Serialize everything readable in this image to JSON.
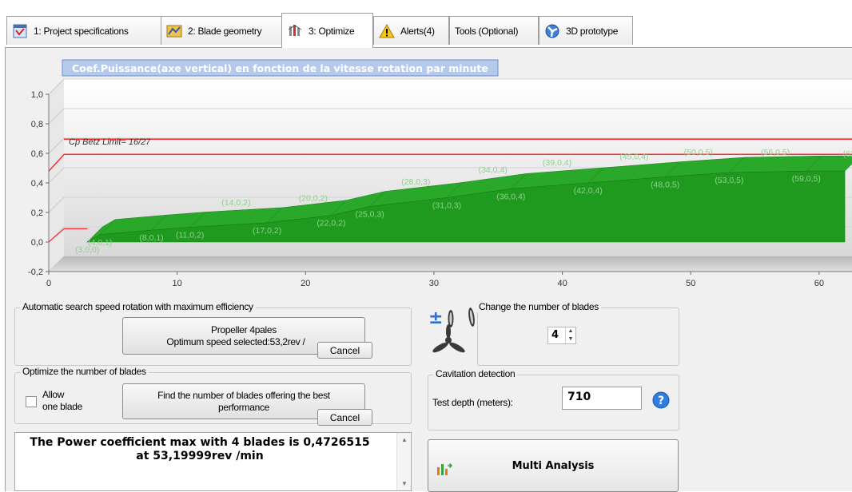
{
  "tabs": [
    {
      "label": "1: Project specifications",
      "icon": "spec-icon"
    },
    {
      "label": "2: Blade geometry",
      "icon": "geometry-icon"
    },
    {
      "label": "3: Optimize",
      "icon": "optimize-icon"
    },
    {
      "label": "Alerts(4)",
      "icon": "alert-icon"
    },
    {
      "label": "Tools (Optional)",
      "icon": ""
    },
    {
      "label": "3D prototype",
      "icon": "prototype-icon"
    }
  ],
  "chart_data": {
    "type": "area",
    "title": "Coef.Puissance(axe vertical) en fonction de la vitesse rotation par minute",
    "xlim": [
      0,
      62
    ],
    "ylim": [
      -0.2,
      1.0
    ],
    "x_ticks": [
      "0",
      "10",
      "20",
      "30",
      "40",
      "50",
      "60"
    ],
    "y_ticks": [
      "-0,2",
      "0,0",
      "0,2",
      "0,4",
      "0,6",
      "0,8",
      "1,0"
    ],
    "betz_limit": {
      "value": 0.593,
      "label": "Cp Betz Limit= 16/27"
    },
    "series_color": "#1f9a1f",
    "limit_color": "#ff2a2a",
    "front_points": [
      {
        "x": 3,
        "y": 0.0,
        "label": "(3,0,0)"
      },
      {
        "x": 4,
        "y": 0.05,
        "label": "(4,0,1)"
      },
      {
        "x": 8,
        "y": 0.08,
        "label": "(8,0,1)"
      },
      {
        "x": 11,
        "y": 0.1,
        "label": "(11,0,2)"
      },
      {
        "x": 17,
        "y": 0.13,
        "label": "(17,0,2)"
      },
      {
        "x": 22,
        "y": 0.18,
        "label": "(22,0,2)"
      },
      {
        "x": 25,
        "y": 0.24,
        "label": "(25,0,3)"
      },
      {
        "x": 31,
        "y": 0.3,
        "label": "(31,0,3)"
      },
      {
        "x": 36,
        "y": 0.36,
        "label": "(36,0,4)"
      },
      {
        "x": 42,
        "y": 0.4,
        "label": "(42,0,4)"
      },
      {
        "x": 48,
        "y": 0.44,
        "label": "(48,0,5)"
      },
      {
        "x": 53,
        "y": 0.47,
        "label": "(53,0,5)"
      },
      {
        "x": 59,
        "y": 0.48,
        "label": "(59,0,5)"
      }
    ],
    "back_points": [
      {
        "x": 14,
        "y": 0.22,
        "label": "(14,0,2)"
      },
      {
        "x": 20,
        "y": 0.25,
        "label": "(20,0,2)"
      },
      {
        "x": 28,
        "y": 0.36,
        "label": "(28,0,3)"
      },
      {
        "x": 34,
        "y": 0.44,
        "label": "(34,0,4)"
      },
      {
        "x": 39,
        "y": 0.49,
        "label": "(39,0,4)"
      },
      {
        "x": 45,
        "y": 0.53,
        "label": "(45,0,4)"
      },
      {
        "x": 50,
        "y": 0.56,
        "label": "(50,0,5)"
      },
      {
        "x": 56,
        "y": 0.56,
        "label": "(56,0,5)"
      },
      {
        "x": 62,
        "y": 0.55,
        "label": "(62,0"
      }
    ]
  },
  "auto_search": {
    "legend": "Automatic search speed rotation with maximum efficiency",
    "button_line1": "Propeller 4pales",
    "button_line2": "Optimum speed selected:53,2rev /",
    "cancel": "Cancel"
  },
  "optimize_blades": {
    "legend": "Optimize the number of blades",
    "checkbox_label_1": "Allow",
    "checkbox_label_2": "one blade",
    "button_line1": "Find the number of blades offering the best",
    "button_line2": "performance",
    "cancel": "Cancel"
  },
  "blades": {
    "legend": "Change the number of blades",
    "value": "4"
  },
  "cavitation": {
    "legend": "Cavitation  detection",
    "label": "Test depth (meters):",
    "value": "710"
  },
  "result": {
    "line1": "The Power coefficient  max with 4 blades is 0,4726515",
    "line2": "at 53,19999rev /min"
  },
  "multi_analysis": {
    "label": "Multi Analysis"
  }
}
